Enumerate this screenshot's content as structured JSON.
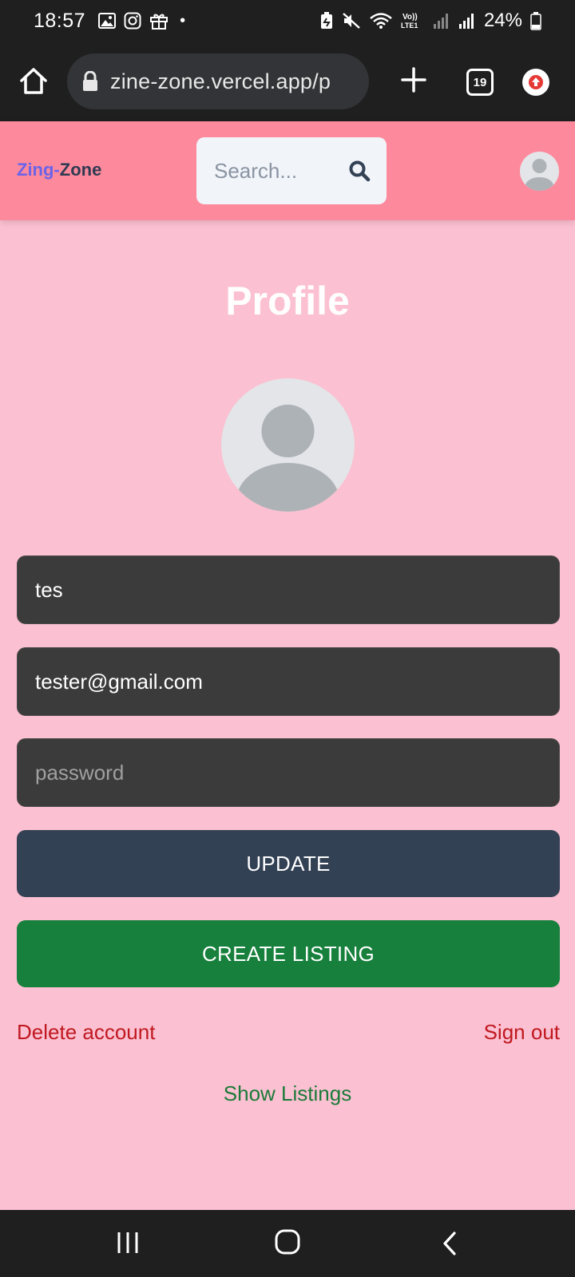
{
  "status_bar": {
    "time": "18:57",
    "battery": "24%",
    "icons": [
      "gallery-icon",
      "instagram-icon",
      "gift-icon",
      "notification-dot",
      "battery-saver-icon",
      "mute-icon",
      "wifi-icon",
      "volte-icon",
      "signal-icon",
      "signal-icon",
      "battery-icon"
    ]
  },
  "browser": {
    "url": "zine-zone.vercel.app/p",
    "tab_count": "19",
    "icons": [
      "home-icon",
      "lock-icon",
      "plus-icon",
      "tabs-icon",
      "update-icon"
    ]
  },
  "header": {
    "logo_part1": "Zing-",
    "logo_part2": "Zone",
    "search_placeholder": "Search...",
    "logo_colors": {
      "part1": "#6a63e8",
      "part2": "#2e3a52"
    },
    "background": "#fd8a9c"
  },
  "profile": {
    "title": "Profile",
    "username": "tes",
    "email": "tester@gmail.com",
    "password_placeholder": "password",
    "update_label": "UPDATE",
    "create_listing_label": "CREATE LISTING",
    "delete_account_label": "Delete account",
    "sign_out_label": "Sign out",
    "show_listings_label": "Show Listings"
  },
  "colors": {
    "page_bg": "#fbc0d1",
    "update_button": "#334155",
    "create_button": "#16803c",
    "danger_link": "#c0181f",
    "success_link": "#1a7a39"
  },
  "nav_bar": {
    "icons": [
      "recents-icon",
      "home-nav-icon",
      "back-icon"
    ]
  }
}
